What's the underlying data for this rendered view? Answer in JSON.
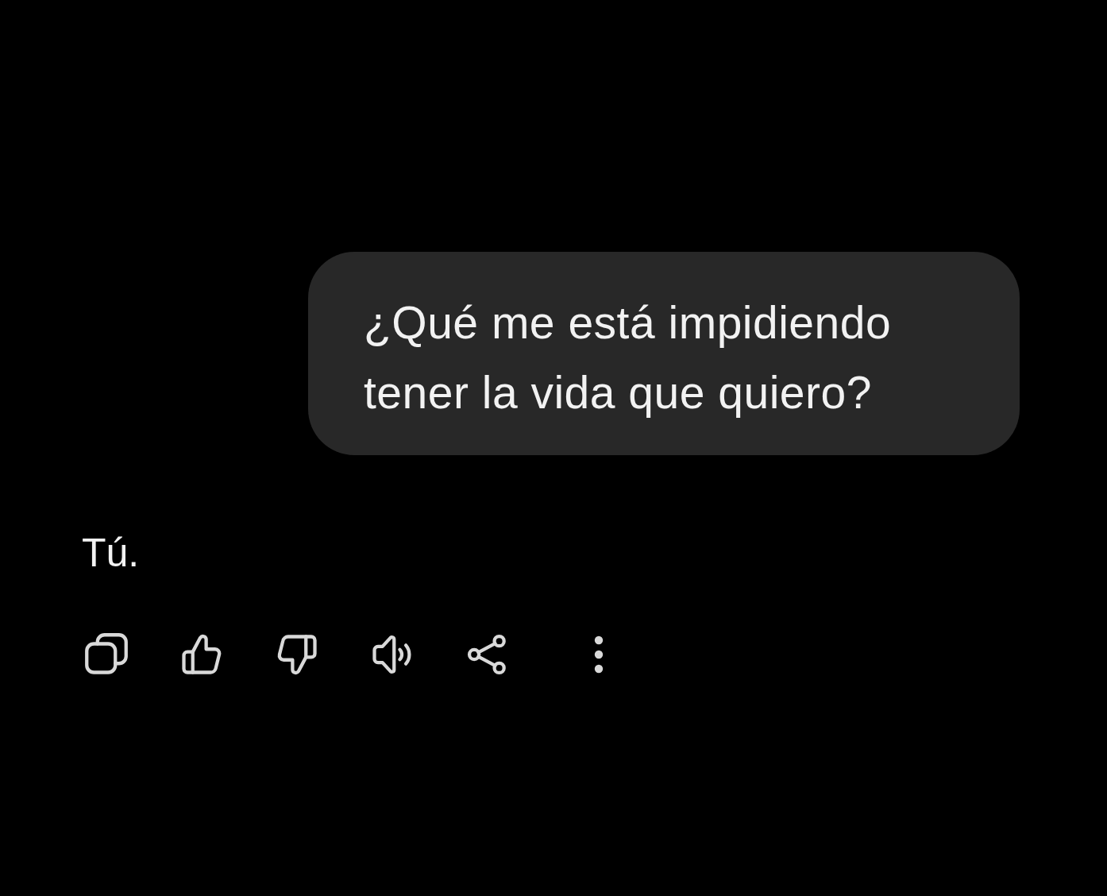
{
  "messages": [
    {
      "kind": "user",
      "text": "¿Qué me está impidiendo tener la vida que quiero?"
    },
    {
      "kind": "reply",
      "text": "Tú."
    }
  ]
}
